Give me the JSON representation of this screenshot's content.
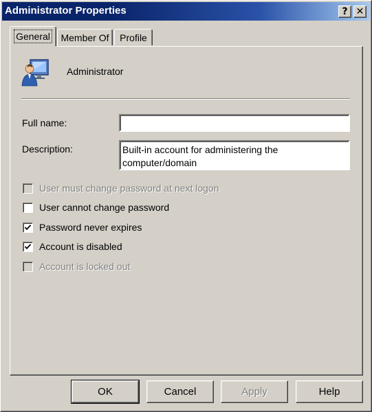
{
  "window": {
    "title": "Administrator Properties",
    "help_glyph": "?",
    "close_glyph": "✕"
  },
  "tabs": [
    {
      "label": "General",
      "active": true
    },
    {
      "label": "Member Of",
      "active": false
    },
    {
      "label": "Profile",
      "active": false
    }
  ],
  "general": {
    "icon": "user-icon",
    "username": "Administrator",
    "full_name_label": "Full name:",
    "full_name_value": "",
    "description_label": "Description:",
    "description_value": "Built-in account for administering the computer/domain",
    "options": [
      {
        "label": "User must change password at next logon",
        "checked": false,
        "enabled": false
      },
      {
        "label": "User cannot change password",
        "checked": false,
        "enabled": true
      },
      {
        "label": "Password never expires",
        "checked": true,
        "enabled": true
      },
      {
        "label": "Account is disabled",
        "checked": true,
        "enabled": true
      },
      {
        "label": "Account is locked out",
        "checked": false,
        "enabled": false
      }
    ]
  },
  "buttons": {
    "ok": "OK",
    "cancel": "Cancel",
    "apply": "Apply",
    "help": "Help"
  },
  "colors": {
    "title_bar": "#0a246a",
    "face": "#d4d0c8",
    "disabled_text": "#808080"
  }
}
